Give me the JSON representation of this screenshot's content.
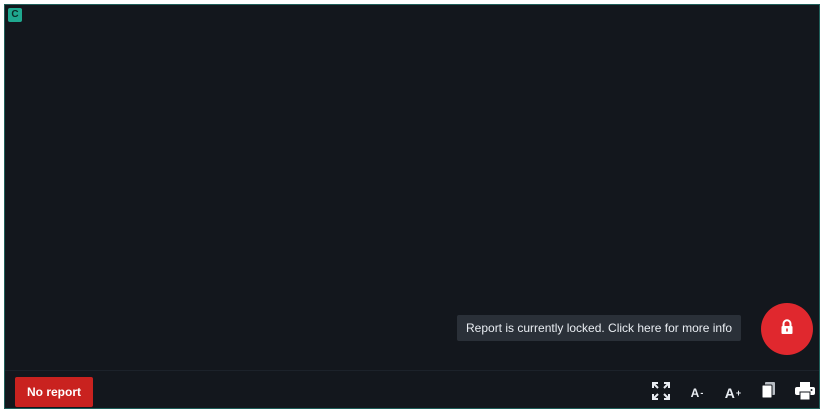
{
  "viewer": {
    "corner_badge": "C"
  },
  "lock": {
    "tooltip": "Report is currently locked. Click here for more info",
    "icon": "lock-icon",
    "color": "#e0282e"
  },
  "footer": {
    "no_report_label": "No report",
    "no_report_color": "#c9221f",
    "tools": [
      {
        "name": "fullscreen",
        "icon": "expand-icon"
      },
      {
        "name": "decrease-font",
        "label": "A",
        "suffix": "-"
      },
      {
        "name": "increase-font",
        "label": "A",
        "suffix": "+"
      },
      {
        "name": "copy",
        "icon": "copy-icon"
      },
      {
        "name": "print",
        "icon": "print-icon"
      }
    ]
  }
}
